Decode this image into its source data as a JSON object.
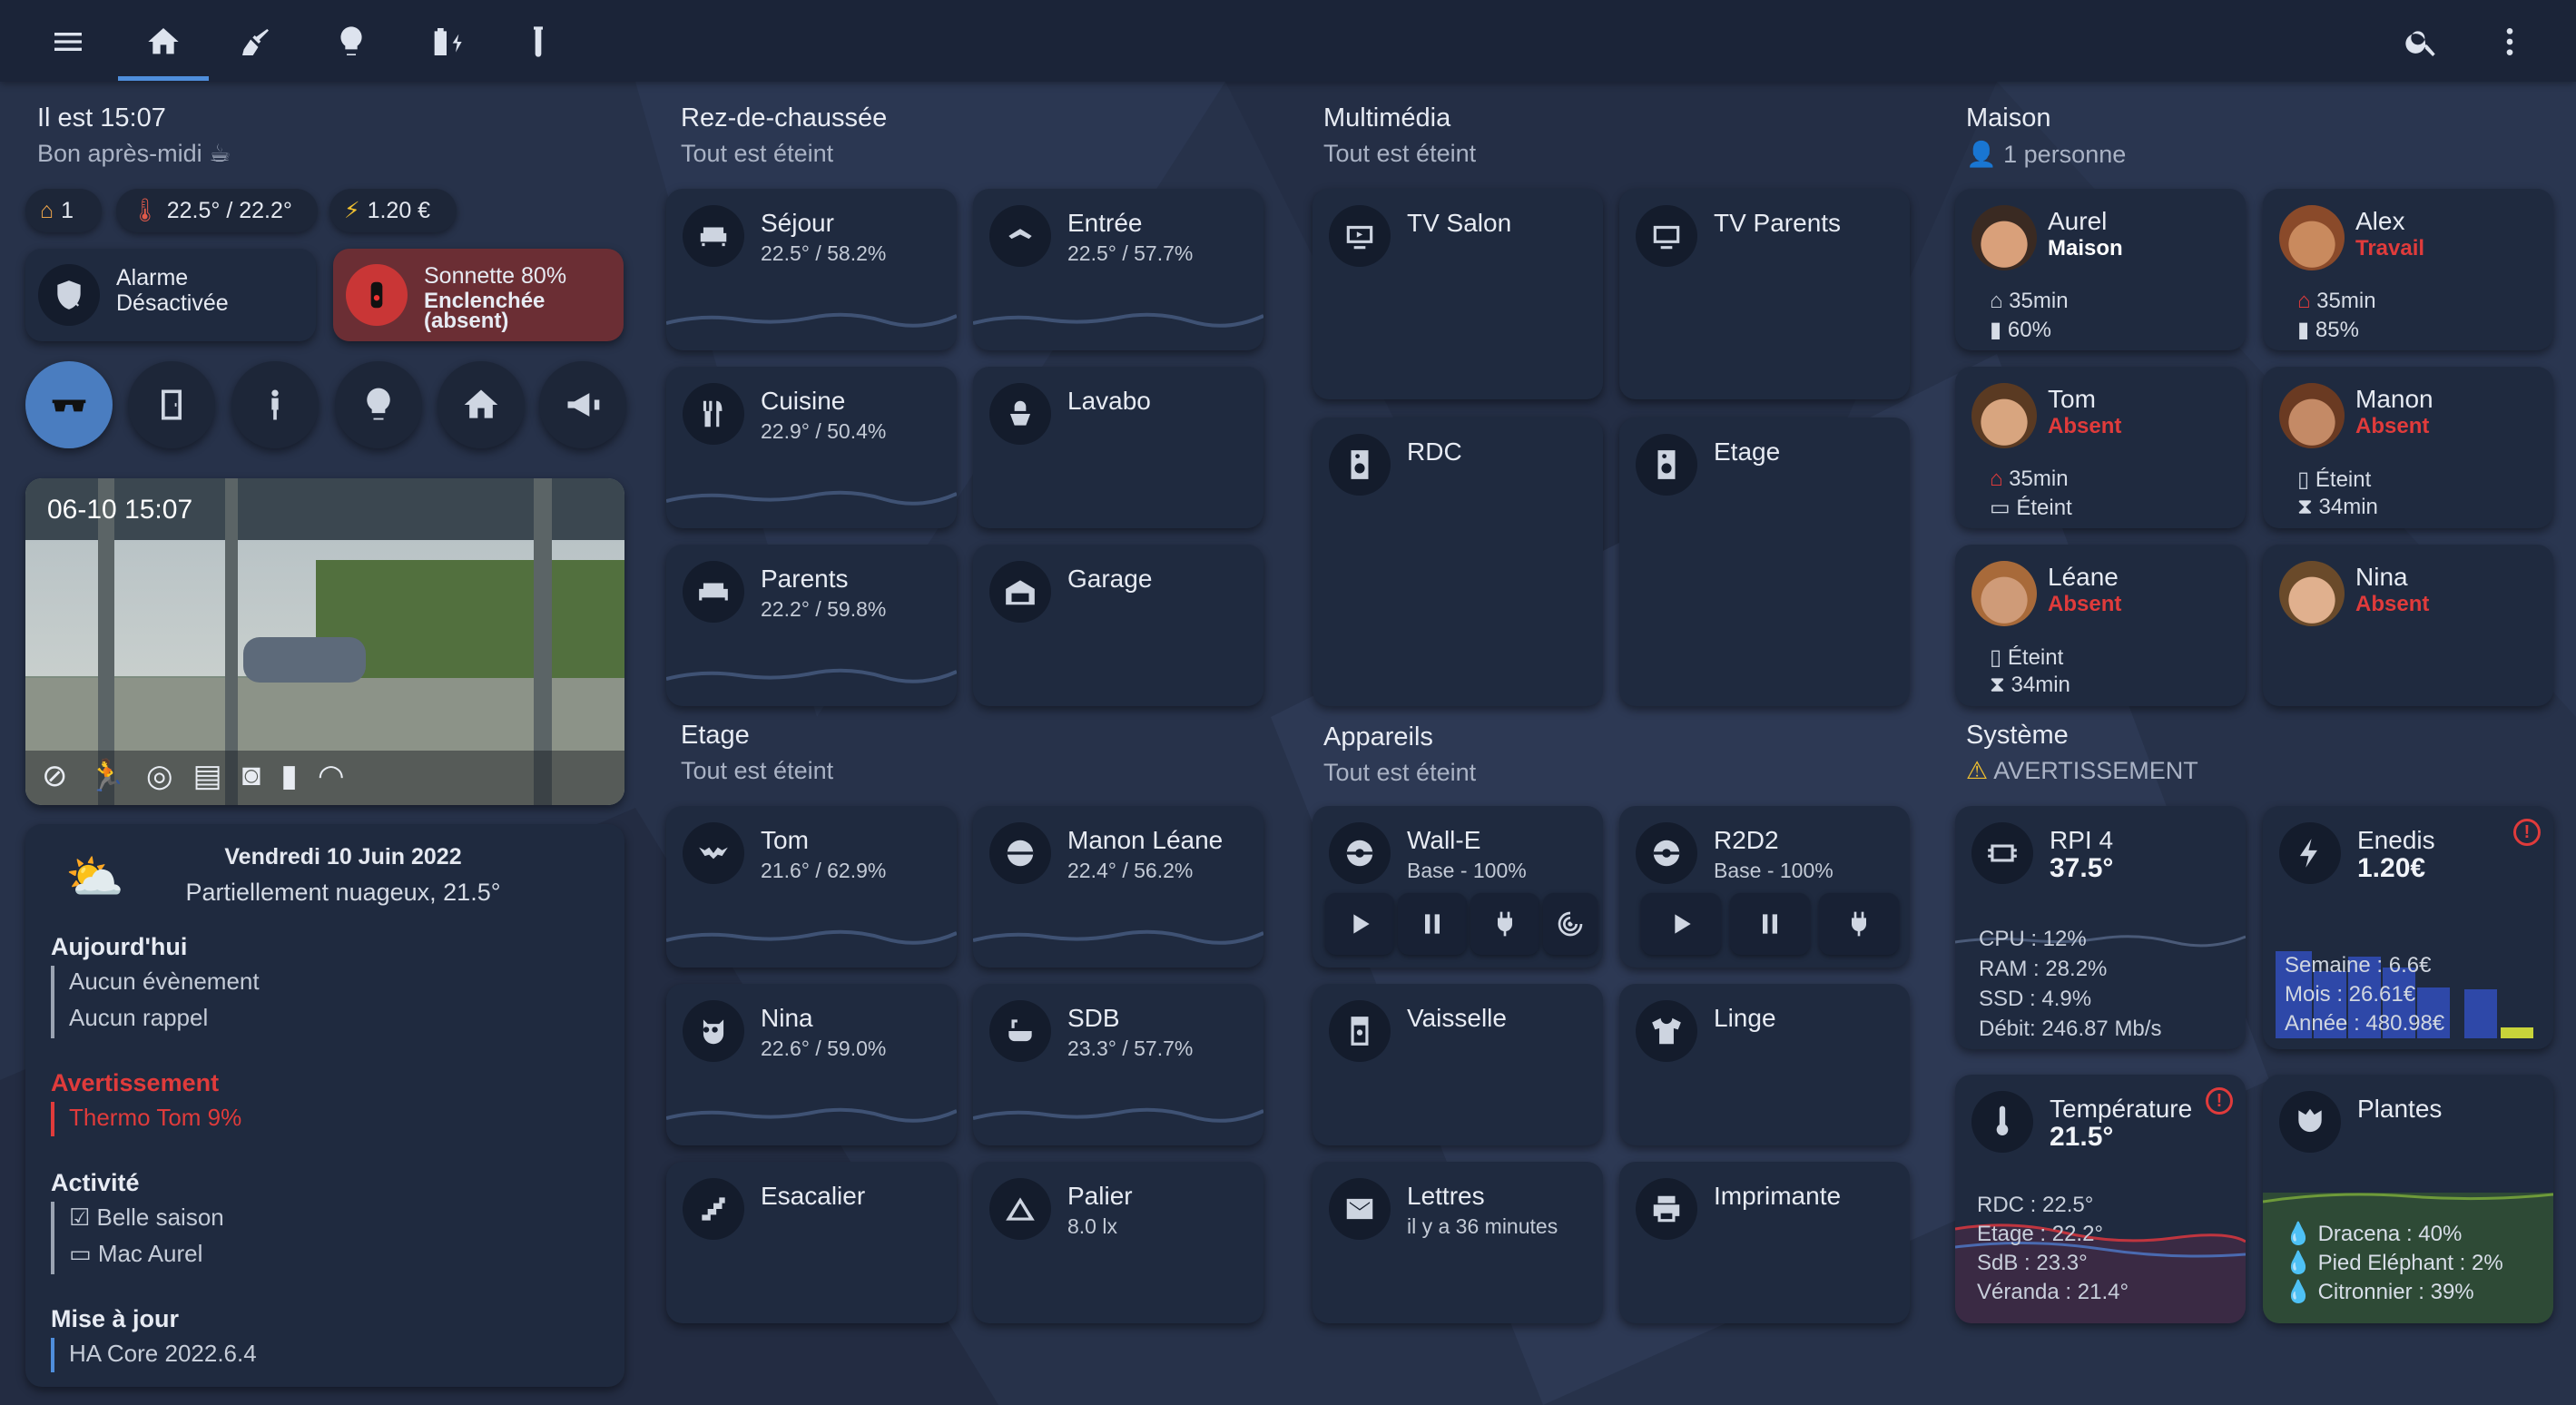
{
  "colors": {
    "accent": "#4f8edc",
    "warning": "#e03b3b",
    "absent": "#e03b3b",
    "travail": "#e03b3b",
    "background": "#27324a",
    "card": "#1f2a3f"
  },
  "topbar": {
    "icons": [
      "menu-icon",
      "home-icon",
      "broom-icon",
      "lightbulb-icon",
      "battery-charging-icon",
      "flask-icon",
      "search-icon",
      "more-vert-icon"
    ]
  },
  "left": {
    "time": "Il est 15:07",
    "greeting": "Bon après-midi ☕",
    "chips": {
      "home": "1",
      "temp": "22.5° / 22.2°",
      "energy": "1.20 €"
    },
    "alarm": {
      "title": "Alarme",
      "state": "Désactivée"
    },
    "bell": {
      "title": "Sonnette 80%",
      "state": "Enclenchée",
      "state2": "(absent)"
    },
    "camera": {
      "timestamp": "06-10 15:07"
    },
    "calendar": {
      "date": "Vendredi 10 Juin 2022",
      "weather": "Partiellement nuageux, 21.5°",
      "today_h": "Aujourd'hui",
      "today_1": "Aucun évènement",
      "today_2": "Aucun rappel",
      "warn_h": "Avertissement",
      "warn_1": "Thermo Tom 9%",
      "act_h": "Activité",
      "act_1": "Belle saison",
      "act_2": "Mac Aurel",
      "upd_h": "Mise à jour",
      "upd_1": "HA Core 2022.6.4"
    }
  },
  "rdc": {
    "title": "Rez-de-chaussée",
    "subtitle": "Tout est éteint",
    "rooms": [
      {
        "name": "Séjour",
        "value": "22.5° / 58.2%"
      },
      {
        "name": "Entrée",
        "value": "22.5° / 57.7%"
      },
      {
        "name": "Cuisine",
        "value": "22.9° / 50.4%"
      },
      {
        "name": "Lavabo",
        "value": ""
      },
      {
        "name": "Parents",
        "value": "22.2° / 59.8%"
      },
      {
        "name": "Garage",
        "value": ""
      }
    ]
  },
  "etage": {
    "title": "Etage",
    "subtitle": "Tout est éteint",
    "rooms": [
      {
        "name": "Tom",
        "value": "21.6° / 62.9%"
      },
      {
        "name": "Manon Léane",
        "value": "22.4° / 56.2%"
      },
      {
        "name": "Nina",
        "value": "22.6° / 59.0%"
      },
      {
        "name": "SDB",
        "value": "23.3° / 57.7%"
      },
      {
        "name": "Esacalier",
        "value": ""
      },
      {
        "name": "Palier",
        "value": "8.0 lx"
      }
    ]
  },
  "multimedia": {
    "title": "Multimédia",
    "subtitle": "Tout est éteint",
    "items": [
      {
        "name": "TV Salon"
      },
      {
        "name": "TV Parents"
      },
      {
        "name": "RDC"
      },
      {
        "name": "Etage"
      }
    ]
  },
  "appareils": {
    "title": "Appareils",
    "subtitle": "Tout est éteint",
    "walle": {
      "name": "Wall-E",
      "state": "Base - 100%"
    },
    "r2d2": {
      "name": "R2D2",
      "state": "Base - 100%"
    },
    "vaisselle": "Vaisselle",
    "linge": "Linge",
    "lettres": {
      "name": "Lettres",
      "state": "il y a 36 minutes"
    },
    "imprimante": "Imprimante"
  },
  "maison": {
    "title": "Maison",
    "subtitle": "1 personne",
    "people": [
      {
        "name": "Aurel",
        "state": "Maison",
        "l1": "35min",
        "l2": "60%"
      },
      {
        "name": "Alex",
        "state": "Travail",
        "l1": "35min",
        "l2": "85%"
      },
      {
        "name": "Tom",
        "state": "Absent",
        "l1": "35min",
        "l2": "Éteint"
      },
      {
        "name": "Manon",
        "state": "Absent",
        "l1": "Éteint",
        "l2": "34min"
      },
      {
        "name": "Léane",
        "state": "Absent",
        "l1": "Éteint",
        "l2": "34min"
      },
      {
        "name": "Nina",
        "state": "Absent",
        "l1": "",
        "l2": ""
      }
    ]
  },
  "systeme": {
    "title": "Système",
    "subtitle": "AVERTISSEMENT",
    "rpi": {
      "name": "RPI 4",
      "value": "37.5°",
      "cpu": "CPU : 12%",
      "ram": "RAM : 28.2%",
      "ssd": "SSD : 4.9%",
      "debit": "Débit: 246.87 Mb/s"
    },
    "enedis": {
      "name": "Enedis",
      "value": "1.20€",
      "semaine": "Semaine : 6.6€",
      "mois": "Mois : 26.61€",
      "annee": "Année : 480.98€"
    },
    "temp": {
      "name": "Température",
      "value": "21.5°",
      "rdc": "RDC : 22.5°",
      "etage": "Etage : 22.2°",
      "sdb": "SdB : 23.3°",
      "veranda": "Véranda : 21.4°"
    },
    "plantes": {
      "name": "Plantes",
      "p1": "Dracena : 40%",
      "p2": "Pied Eléphant : 2%",
      "p3": "Citronnier : 39%"
    }
  }
}
